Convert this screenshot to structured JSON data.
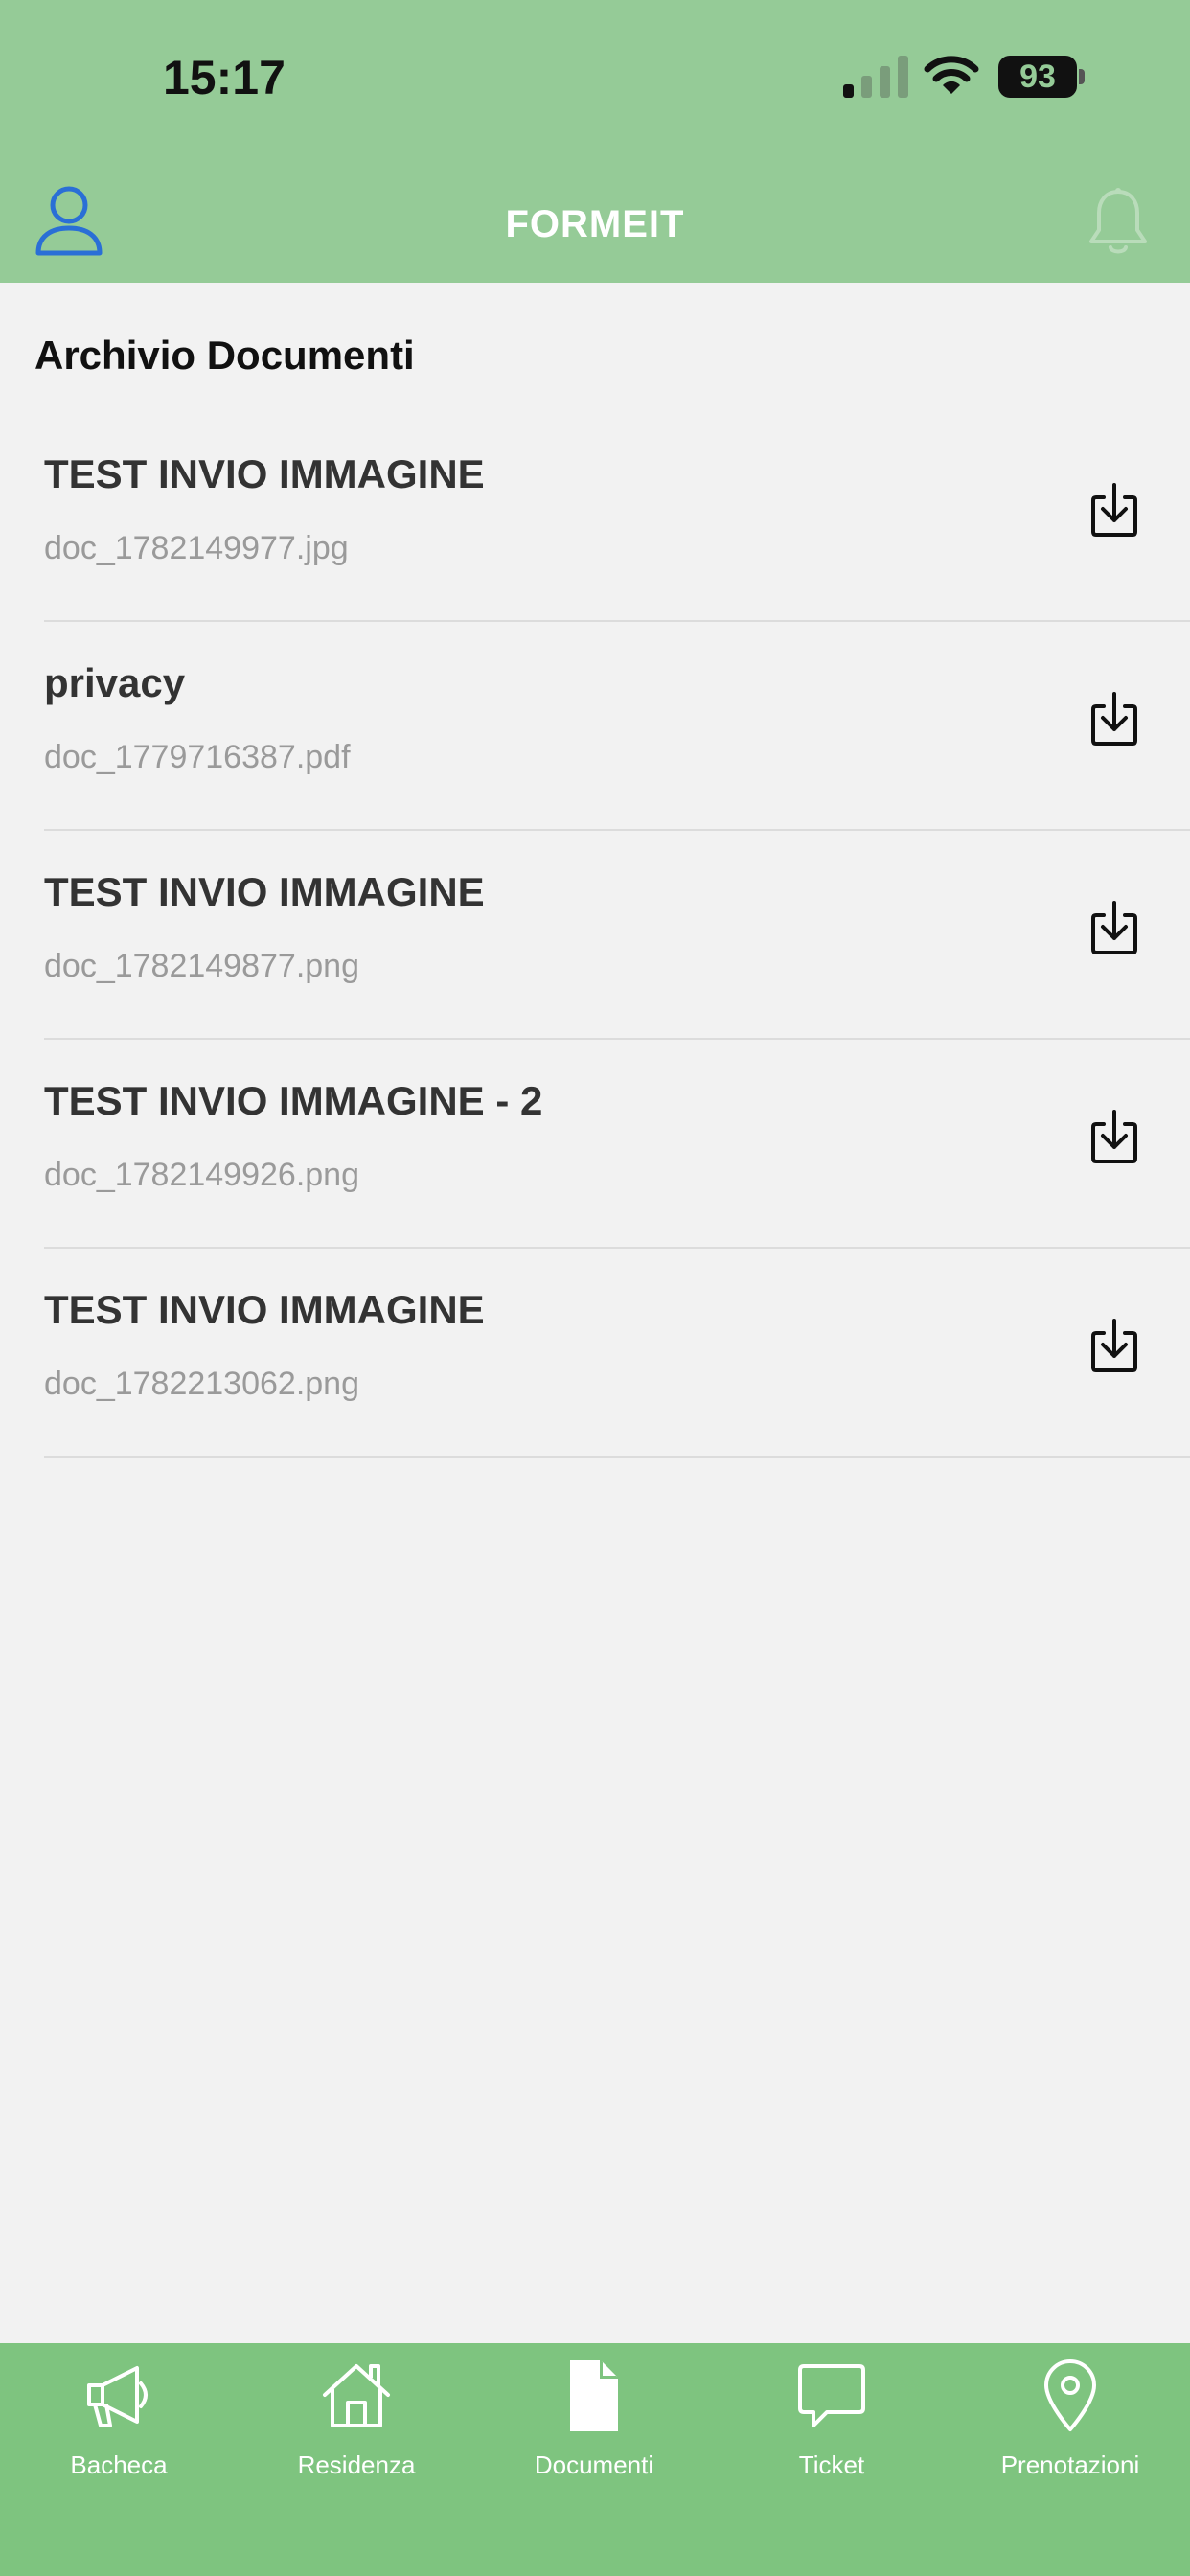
{
  "status_bar": {
    "time": "15:17",
    "battery": "93"
  },
  "app_bar": {
    "title": "FORMEIT"
  },
  "section": {
    "title": "Archivio Documenti"
  },
  "documents": [
    {
      "title": "TEST INVIO IMMAGINE",
      "file": "doc_1782149977.jpg"
    },
    {
      "title": "privacy",
      "file": "doc_1779716387.pdf"
    },
    {
      "title": "TEST INVIO IMMAGINE",
      "file": "doc_1782149877.png"
    },
    {
      "title": "TEST INVIO IMMAGINE - 2",
      "file": "doc_1782149926.png"
    },
    {
      "title": "TEST INVIO IMMAGINE",
      "file": "doc_1782213062.png"
    }
  ],
  "tabs": [
    {
      "label": "Bacheca",
      "icon": "megaphone-icon"
    },
    {
      "label": "Residenza",
      "icon": "home-icon"
    },
    {
      "label": "Documenti",
      "icon": "document-icon"
    },
    {
      "label": "Ticket",
      "icon": "chat-bubble-icon"
    },
    {
      "label": "Prenotazioni",
      "icon": "location-pin-icon"
    }
  ],
  "colors": {
    "header_bg": "#95cb97",
    "tabbar_bg": "#7ec47f",
    "content_bg": "#f2f2f2",
    "user_icon": "#2a6fd6"
  }
}
